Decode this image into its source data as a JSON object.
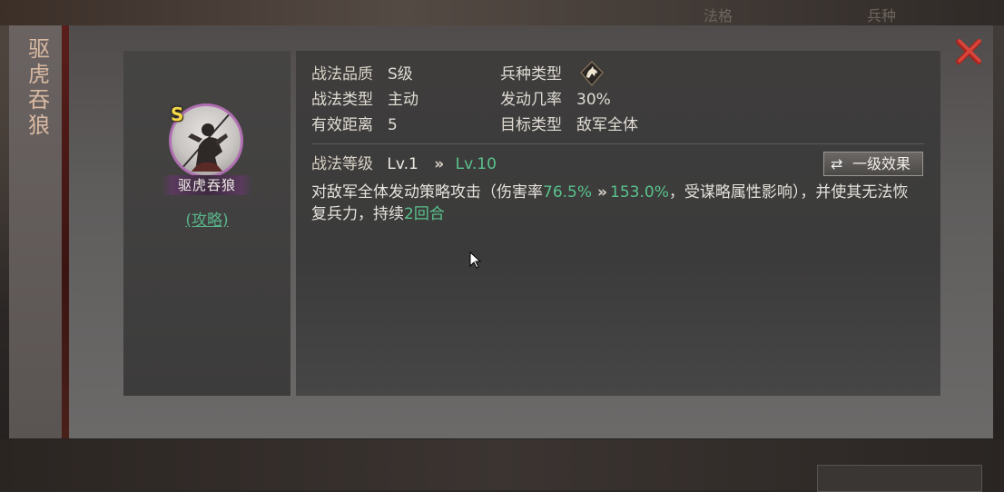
{
  "background": {
    "tabs": [
      "法格",
      "兵种"
    ]
  },
  "skill": {
    "title_chars": [
      "驱",
      "虎",
      "吞",
      "狼"
    ],
    "name": "驱虎吞狼",
    "grade_badge": "S",
    "guide_link": "(攻略)",
    "quality_label": "战法品质",
    "quality_value": "S级",
    "troop_label": "兵种类型",
    "troop_icon": "horse-icon",
    "type_label": "战法类型",
    "type_value": "主动",
    "rate_label": "发动几率",
    "rate_value": "30%",
    "range_label": "有效距离",
    "range_value": "5",
    "target_label": "目标类型",
    "target_value": "敌军全体",
    "level_label": "战法等级",
    "level_from": "Lv.1",
    "level_to": "Lv.10",
    "effect_button": "一级效果",
    "desc_1": "对敌军全体发动策略攻击（伤害率",
    "desc_dmg_from": "76.5%",
    "desc_dmg_to": "153.0%",
    "desc_2": "，受谋略属性影响），并使其无法恢复兵力，持续",
    "desc_turns": "2回合"
  },
  "colors": {
    "accent_green": "#59c38d",
    "close_red": "#c0392b",
    "grade_gold": "#f2d84b"
  }
}
